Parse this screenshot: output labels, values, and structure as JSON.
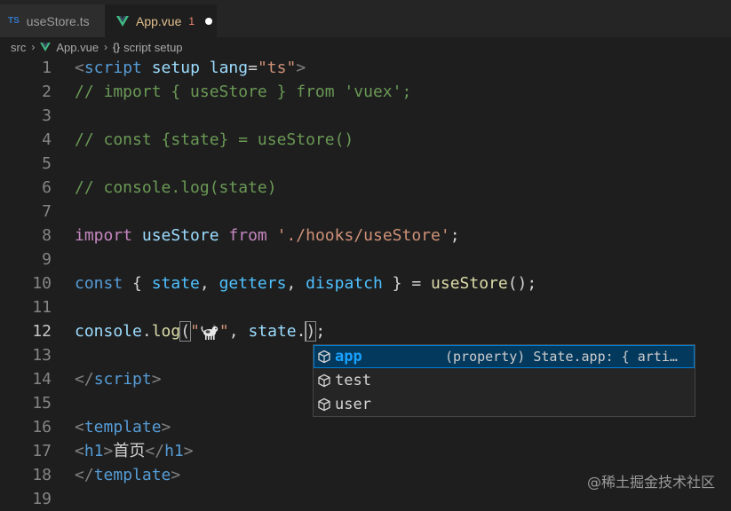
{
  "tabs": [
    {
      "icon": "typescript-icon",
      "icon_text": "TS",
      "label": "useStore.ts"
    },
    {
      "icon": "vue-icon",
      "label": "App.vue",
      "problems": "1",
      "modified": true
    }
  ],
  "breadcrumb": {
    "folder": "src",
    "file": "App.vue",
    "symbol_icon": "{}",
    "symbol": "script setup"
  },
  "lines": [
    {
      "n": "1",
      "tokens": [
        [
          "<",
          "punc"
        ],
        [
          "script",
          "tag"
        ],
        [
          " ",
          "plain"
        ],
        [
          "setup",
          "attr"
        ],
        [
          " ",
          "plain"
        ],
        [
          "lang",
          "attr"
        ],
        [
          "=",
          "plain"
        ],
        [
          "\"ts\"",
          "str"
        ],
        [
          ">",
          "punc"
        ]
      ]
    },
    {
      "n": "2",
      "tokens": [
        [
          "// import { useStore } from 'vuex';",
          "com"
        ]
      ]
    },
    {
      "n": "3",
      "tokens": []
    },
    {
      "n": "4",
      "tokens": [
        [
          "// const {state} = useStore()",
          "com"
        ]
      ]
    },
    {
      "n": "5",
      "tokens": []
    },
    {
      "n": "6",
      "tokens": [
        [
          "// console.log(state)",
          "com"
        ]
      ]
    },
    {
      "n": "7",
      "tokens": []
    },
    {
      "n": "8",
      "tokens": [
        [
          "import",
          "kw"
        ],
        [
          " ",
          "plain"
        ],
        [
          "useStore",
          "var"
        ],
        [
          " ",
          "plain"
        ],
        [
          "from",
          "kw"
        ],
        [
          " ",
          "plain"
        ],
        [
          "'./hooks/useStore'",
          "str"
        ],
        [
          ";",
          "plain"
        ]
      ]
    },
    {
      "n": "9",
      "tokens": []
    },
    {
      "n": "10",
      "tokens": [
        [
          "const",
          "kwb"
        ],
        [
          " { ",
          "plain"
        ],
        [
          "state",
          "const"
        ],
        [
          ", ",
          "plain"
        ],
        [
          "getters",
          "const"
        ],
        [
          ", ",
          "plain"
        ],
        [
          "dispatch",
          "const"
        ],
        [
          " } = ",
          "plain"
        ],
        [
          "useStore",
          "fn"
        ],
        [
          "();",
          "plain"
        ]
      ]
    },
    {
      "n": "11",
      "tokens": []
    },
    {
      "n": "12",
      "current": true,
      "tokens": [
        [
          "console",
          "var"
        ],
        [
          ".",
          "plain"
        ],
        [
          "log",
          "fn"
        ],
        [
          "(",
          "parenmatch"
        ],
        [
          "\"",
          "str"
        ],
        [
          "__DOG__",
          "dog"
        ],
        [
          "\"",
          "str"
        ],
        [
          ", ",
          "plain"
        ],
        [
          "state",
          "var"
        ],
        [
          ".",
          "plain"
        ],
        [
          "__CURSOR__",
          "cursor"
        ],
        [
          ")",
          "parenmatch"
        ],
        [
          ";",
          "plain"
        ]
      ]
    },
    {
      "n": "13",
      "tokens": []
    },
    {
      "n": "14",
      "tokens": [
        [
          "</",
          "punc"
        ],
        [
          "script",
          "tag"
        ],
        [
          ">",
          "punc"
        ]
      ]
    },
    {
      "n": "15",
      "tokens": []
    },
    {
      "n": "16",
      "tokens": [
        [
          "<",
          "punc"
        ],
        [
          "template",
          "tag"
        ],
        [
          ">",
          "punc"
        ]
      ]
    },
    {
      "n": "17",
      "tokens": [
        [
          "<",
          "punc"
        ],
        [
          "h1",
          "tag"
        ],
        [
          ">",
          "punc"
        ],
        [
          "首页",
          "plain"
        ],
        [
          "</",
          "punc"
        ],
        [
          "h1",
          "tag"
        ],
        [
          ">",
          "punc"
        ]
      ]
    },
    {
      "n": "18",
      "tokens": [
        [
          "</",
          "punc"
        ],
        [
          "template",
          "tag"
        ],
        [
          ">",
          "punc"
        ]
      ]
    },
    {
      "n": "19",
      "tokens": []
    }
  ],
  "suggest": {
    "items": [
      {
        "label": "app",
        "icon": "property-cube-icon",
        "selected": true,
        "detail": "(property) State.app: { arti…"
      },
      {
        "label": "test",
        "icon": "property-cube-icon",
        "selected": false,
        "detail": ""
      },
      {
        "label": "user",
        "icon": "property-cube-icon",
        "selected": false,
        "detail": ""
      }
    ]
  },
  "watermark": "@稀土掘金技术社区",
  "colors": {
    "editor_bg": "#1e1e1e",
    "tabbar_bg": "#252526",
    "active_tab_text": "#e2c08d",
    "error": "#f48771",
    "suggest_selected": "#04395e",
    "match_highlight": "#18a3ff"
  }
}
